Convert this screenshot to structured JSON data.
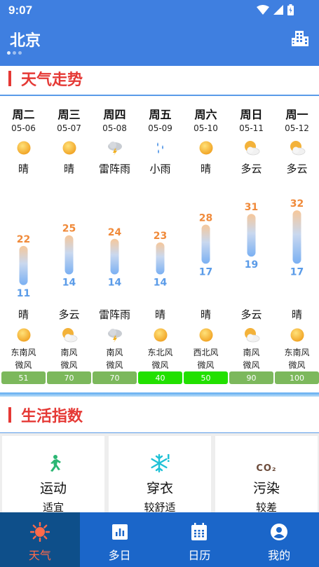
{
  "status": {
    "time": "9:07"
  },
  "app": {
    "city": "北京"
  },
  "section_trend": {
    "title": "天气走势"
  },
  "days": [
    {
      "name": "周二",
      "date": "05-06",
      "day_cond": "晴",
      "day_icon": "sun-icon",
      "high": "22",
      "low": "11",
      "night_cond": "晴",
      "night_icon": "sun-icon",
      "wind_dir": "东南风",
      "wind_level": "微风",
      "aqi": "51",
      "aqi_color": "#7cb85c"
    },
    {
      "name": "周三",
      "date": "05-07",
      "day_cond": "晴",
      "day_icon": "sun-icon",
      "high": "25",
      "low": "14",
      "night_cond": "多云",
      "night_icon": "cloudy-icon",
      "wind_dir": "南风",
      "wind_level": "微风",
      "aqi": "70",
      "aqi_color": "#7cb85c"
    },
    {
      "name": "周四",
      "date": "05-08",
      "day_cond": "雷阵雨",
      "day_icon": "thunderstorm-icon",
      "high": "24",
      "low": "14",
      "night_cond": "雷阵雨",
      "night_icon": "thunderstorm-icon",
      "wind_dir": "南风",
      "wind_level": "微风",
      "aqi": "70",
      "aqi_color": "#7cb85c"
    },
    {
      "name": "周五",
      "date": "05-09",
      "day_cond": "小雨",
      "day_icon": "light-rain-icon",
      "high": "23",
      "low": "14",
      "night_cond": "晴",
      "night_icon": "sun-icon",
      "wind_dir": "东北风",
      "wind_level": "微风",
      "aqi": "40",
      "aqi_color": "#22e000"
    },
    {
      "name": "周六",
      "date": "05-10",
      "day_cond": "晴",
      "day_icon": "sun-icon",
      "high": "28",
      "low": "17",
      "night_cond": "晴",
      "night_icon": "sun-icon",
      "wind_dir": "西北风",
      "wind_level": "微风",
      "aqi": "50",
      "aqi_color": "#22e000"
    },
    {
      "name": "周日",
      "date": "05-11",
      "day_cond": "多云",
      "day_icon": "cloudy-icon",
      "high": "31",
      "low": "19",
      "night_cond": "多云",
      "night_icon": "cloudy-icon",
      "wind_dir": "南风",
      "wind_level": "微风",
      "aqi": "90",
      "aqi_color": "#7cb85c"
    },
    {
      "name": "周一",
      "date": "05-12",
      "day_cond": "多云",
      "day_icon": "cloudy-icon",
      "high": "32",
      "low": "17",
      "night_cond": "晴",
      "night_icon": "sun-icon",
      "wind_dir": "东南风",
      "wind_level": "微风",
      "aqi": "100",
      "aqi_color": "#7cb85c"
    }
  ],
  "section_life": {
    "title": "生活指数"
  },
  "life_cards": [
    {
      "title": "运动",
      "value": "适宜",
      "icon": "running-icon"
    },
    {
      "title": "穿衣",
      "value": "较舒适",
      "icon": "snowflake-icon"
    },
    {
      "title": "污染",
      "value": "较差",
      "icon": "co2-icon",
      "icon_text": "CO₂"
    }
  ],
  "nav": [
    {
      "label": "天气",
      "icon": "sun-icon",
      "active": true
    },
    {
      "label": "多日",
      "icon": "chart-icon",
      "active": false
    },
    {
      "label": "日历",
      "icon": "calendar-icon",
      "active": false
    },
    {
      "label": "我的",
      "icon": "user-icon",
      "active": false
    }
  ]
}
